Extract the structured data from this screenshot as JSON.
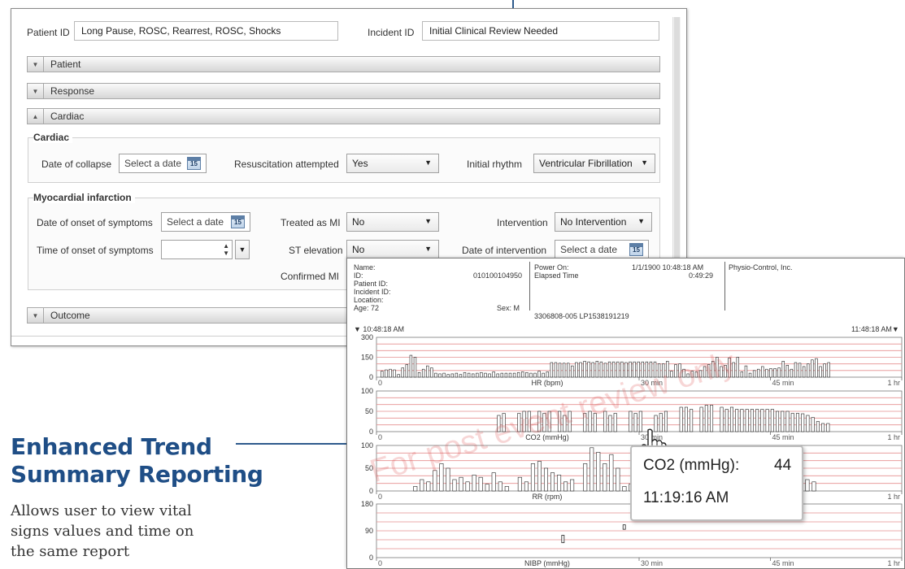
{
  "form": {
    "patient_id_label": "Patient ID",
    "patient_id_value": "Long Pause, ROSC, Rearrest, ROSC, Shocks",
    "incident_id_label": "Incident ID",
    "incident_id_value": "Initial Clinical Review Needed",
    "sections": [
      {
        "label": "Patient",
        "state": "collapsed"
      },
      {
        "label": "Response",
        "state": "collapsed"
      },
      {
        "label": "Cardiac",
        "state": "expanded"
      },
      {
        "label": "Outcome",
        "state": "collapsed"
      }
    ],
    "cardiac": {
      "group_title": "Cardiac",
      "date_of_collapse_label": "Date of collapse",
      "date_of_collapse_placeholder": "Select a date",
      "resuscitation_label": "Resuscitation attempted",
      "resuscitation_value": "Yes",
      "initial_rhythm_label": "Initial rhythm",
      "initial_rhythm_value": "Ventricular Fibrillation"
    },
    "mi": {
      "group_title": "Myocardial infarction",
      "date_onset_label": "Date of onset of symptoms",
      "date_onset_placeholder": "Select a date",
      "time_onset_label": "Time of onset of symptoms",
      "treated_label": "Treated as MI",
      "treated_value": "No",
      "st_label": "ST elevation",
      "st_value": "No",
      "confirmed_label": "Confirmed MI",
      "intervention_label": "Intervention",
      "intervention_value": "No Intervention",
      "date_intervention_label": "Date of intervention",
      "date_intervention_placeholder": "Select a date"
    },
    "calendar_day": "15"
  },
  "report": {
    "header": {
      "name_label": "Name:",
      "id_label": "ID:",
      "id_value": "010100104950",
      "patient_id_label": "Patient ID:",
      "incident_id_label": "Incident ID:",
      "location_label": "Location:",
      "age": "Age: 72",
      "sex": "Sex: M",
      "power_on_label": "Power On:",
      "power_on_value": "1/1/1900 10:48:18 AM",
      "elapsed_label": "Elapsed Time",
      "elapsed_value": "0:49:29",
      "device": "3306808-005 LP1538191219",
      "company": "Physio-Control, Inc."
    },
    "start_time": "▼ 10:48:18 AM",
    "end_time": "11:48:18 AM▼",
    "watermark": "For post event review only"
  },
  "chart_data": [
    {
      "type": "bar",
      "ylabel": "HR (bpm)",
      "yticks": [
        0,
        150,
        300
      ],
      "ylim": [
        0,
        300
      ],
      "xticks": [
        "0",
        "30 min",
        "45 min",
        "1 hr"
      ],
      "x_minutes": [
        0,
        30,
        45,
        60
      ],
      "values": [
        45,
        55,
        60,
        55,
        20,
        70,
        95,
        165,
        150,
        35,
        60,
        85,
        70,
        30,
        25,
        30,
        20,
        25,
        30,
        20,
        35,
        30,
        25,
        30,
        35,
        30,
        25,
        40,
        25,
        30,
        30,
        30,
        30,
        35,
        40,
        35,
        30,
        30,
        45,
        30,
        40,
        110,
        110,
        105,
        105,
        105,
        85,
        110,
        110,
        120,
        115,
        110,
        120,
        115,
        105,
        115,
        115,
        115,
        115,
        110,
        115,
        115,
        115,
        115,
        115,
        115,
        115,
        100,
        100,
        120,
        45,
        95,
        100,
        60,
        25,
        45,
        40,
        50,
        80,
        95,
        120,
        150,
        80,
        90,
        145,
        110,
        150,
        40,
        85,
        30,
        50,
        60,
        80,
        60,
        65,
        65,
        70,
        120,
        90,
        60,
        110,
        105,
        80,
        100,
        130,
        140,
        80,
        100,
        110
      ]
    },
    {
      "type": "bar",
      "ylabel": "CO2 (mmHg)",
      "yticks": [
        0,
        50,
        100
      ],
      "ylim": [
        0,
        100
      ],
      "xticks": [
        "0",
        "30 min",
        "45 min",
        "1 hr"
      ],
      "x_minutes": [
        0,
        30,
        45,
        60
      ],
      "values": [
        0,
        0,
        0,
        0,
        0,
        0,
        0,
        0,
        0,
        0,
        0,
        0,
        0,
        0,
        0,
        0,
        0,
        0,
        0,
        0,
        0,
        0,
        0,
        40,
        45,
        0,
        0,
        45,
        50,
        50,
        0,
        50,
        45,
        50,
        0,
        50,
        40,
        50,
        0,
        0,
        45,
        50,
        45,
        0,
        50,
        40,
        45,
        0,
        0,
        50,
        45,
        50,
        0,
        0,
        40,
        45,
        50,
        0,
        0,
        60,
        60,
        55,
        0,
        60,
        65,
        65,
        0,
        60,
        55,
        60,
        55,
        55,
        55,
        55,
        55,
        55,
        55,
        55,
        50,
        50,
        50,
        45,
        45,
        44,
        40,
        35,
        25,
        20,
        20
      ]
    },
    {
      "type": "bar",
      "ylabel": "RR (rpm)",
      "yticks": [
        0,
        50,
        100
      ],
      "ylim": [
        0,
        100
      ],
      "xticks": [
        "0",
        "30 min",
        "45 min",
        "1 hr"
      ],
      "x_minutes": [
        0,
        30,
        45,
        60
      ],
      "values": [
        0,
        0,
        0,
        0,
        0,
        10,
        25,
        20,
        45,
        60,
        50,
        25,
        30,
        20,
        35,
        30,
        15,
        40,
        20,
        10,
        0,
        30,
        20,
        60,
        65,
        50,
        40,
        35,
        20,
        25,
        0,
        60,
        95,
        85,
        60,
        80,
        50,
        10,
        15,
        40,
        10,
        40,
        25,
        10,
        30,
        45,
        25,
        50,
        70,
        95,
        80,
        55,
        20,
        15,
        30,
        50,
        70,
        0,
        0,
        5,
        10,
        15,
        20,
        10,
        60,
        25,
        20,
        0,
        0
      ]
    },
    {
      "type": "scatter",
      "ylabel": "NIBP (mmHg)",
      "yticks": [
        0,
        90,
        180
      ],
      "ylim": [
        0,
        180
      ],
      "xticks": [
        "0",
        "30 min",
        "45 min",
        "1 hr"
      ],
      "x_minutes": [
        0,
        30,
        45,
        60
      ],
      "points": [
        {
          "minute": 21.3,
          "systolic": 75,
          "diastolic": 50
        },
        {
          "minute": 28.3,
          "systolic": 110,
          "diastolic": 95
        }
      ]
    }
  ],
  "tooltip": {
    "label": "CO2 (mmHg):",
    "value": "44",
    "time": "11:19:16 AM"
  },
  "caption": {
    "title_line1": "Enhanced Trend",
    "title_line2": "Summary Reporting",
    "text_line1": "Allows user to view vital",
    "text_line2": "signs values and time on",
    "text_line3": "the same report"
  },
  "colors": {
    "brand": "#1f4e86",
    "callout": "#2e5a8c",
    "gridline": "#e58f8f",
    "watermark": "#dc4646"
  }
}
